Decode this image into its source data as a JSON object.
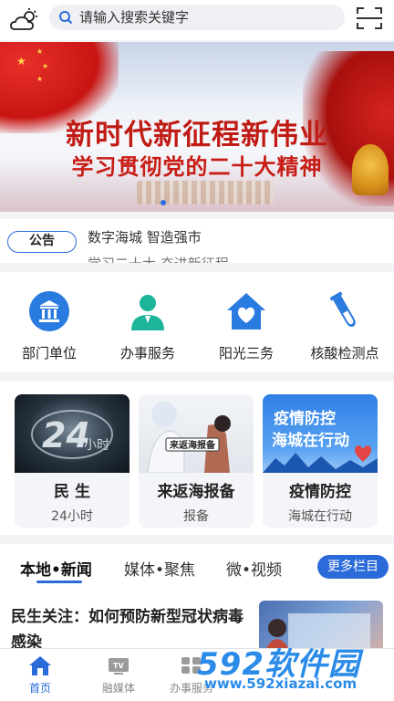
{
  "header": {
    "search_placeholder": "请输入搜索关键字"
  },
  "banner": {
    "title_line1": "新时代新征程新伟业",
    "title_line2": "学习贯彻党的二十大精神"
  },
  "notice": {
    "tag": "公告",
    "items": [
      "数字海城 智造强市",
      "学习二十大 奋进新征程"
    ]
  },
  "services": [
    {
      "label": "部门单位",
      "icon": "government-building-icon",
      "color": "#2a7be0"
    },
    {
      "label": "办事服务",
      "icon": "person-service-icon",
      "color": "#1db59a"
    },
    {
      "label": "阳光三务",
      "icon": "house-heart-icon",
      "color": "#2a7be0"
    },
    {
      "label": "核酸检测点",
      "icon": "test-tube-icon",
      "color": "#2a7be0"
    }
  ],
  "cards": [
    {
      "title": "民 生",
      "sub": "24小时",
      "image_text": "24小时"
    },
    {
      "title": "来返海报备",
      "sub": "报备",
      "image_text": "来返海报备"
    },
    {
      "title": "疫情防控",
      "sub": "海城在行动",
      "image_text": "疫情防控\n海城在行动"
    }
  ],
  "news_tabs": {
    "tabs": [
      "本地•新闻",
      "媒体•聚焦",
      "微•视频"
    ],
    "active_index": 0,
    "more_label": "更多栏目"
  },
  "news": {
    "title": "民生关注：如何预防新型冠状病毒感染"
  },
  "bottom_nav": [
    {
      "label": "首页",
      "icon": "home-icon"
    },
    {
      "label": "融媒体",
      "icon": "tv-icon"
    },
    {
      "label": "办事服务",
      "icon": "service-icon"
    }
  ],
  "watermark": {
    "brand": "592软件园",
    "url": "www.592xiazai.com"
  },
  "colors": {
    "accent": "#2a6ad9",
    "banner_red": "#c01b14"
  }
}
